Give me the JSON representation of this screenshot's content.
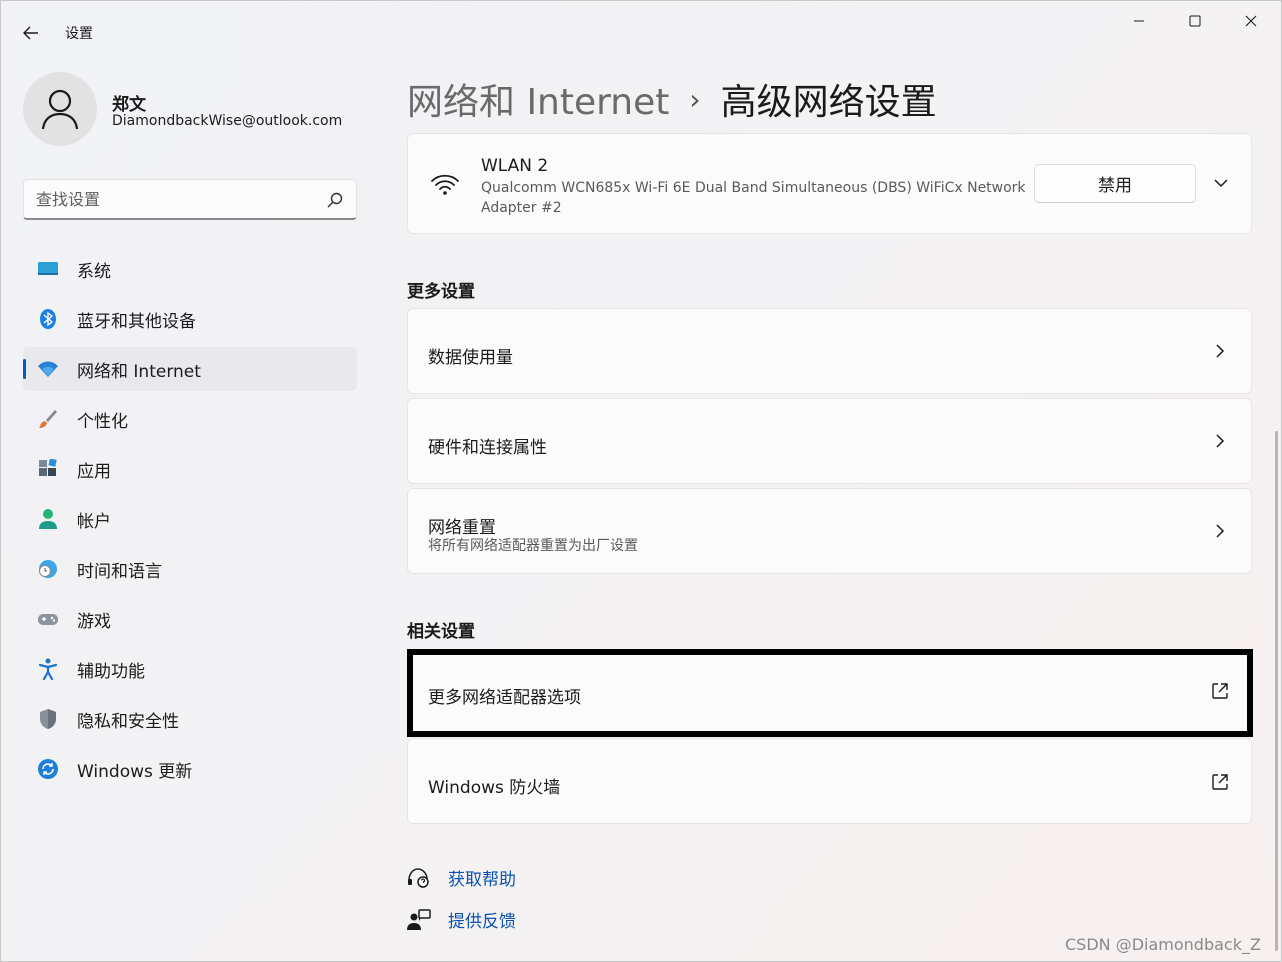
{
  "window": {
    "title": "设置",
    "controls": [
      "minimize",
      "maximize",
      "close"
    ]
  },
  "profile": {
    "name": "郑文",
    "email": "DiamondbackWise@outlook.com"
  },
  "search": {
    "placeholder": "查找设置",
    "value": ""
  },
  "sidebar": {
    "items": [
      {
        "label": "系统",
        "icon": "system-icon",
        "active": false
      },
      {
        "label": "蓝牙和其他设备",
        "icon": "bluetooth-icon",
        "active": false
      },
      {
        "label": "网络和 Internet",
        "icon": "wifi-network-icon",
        "active": true
      },
      {
        "label": "个性化",
        "icon": "brush-icon",
        "active": false
      },
      {
        "label": "应用",
        "icon": "apps-icon",
        "active": false
      },
      {
        "label": "帐户",
        "icon": "account-icon",
        "active": false
      },
      {
        "label": "时间和语言",
        "icon": "globe-clock-icon",
        "active": false
      },
      {
        "label": "游戏",
        "icon": "gamepad-icon",
        "active": false
      },
      {
        "label": "辅助功能",
        "icon": "accessibility-icon",
        "active": false
      },
      {
        "label": "隐私和安全性",
        "icon": "shield-icon",
        "active": false
      },
      {
        "label": "Windows 更新",
        "icon": "update-icon",
        "active": false
      }
    ]
  },
  "breadcrumb": {
    "parent": "网络和 Internet",
    "separator": "›",
    "current": "高级网络设置"
  },
  "adapter": {
    "name": "WLAN 2",
    "description": "Qualcomm WCN685x Wi-Fi 6E Dual Band Simultaneous (DBS) WiFiCx Network Adapter #2",
    "button": "禁用"
  },
  "more_settings": {
    "title": "更多设置",
    "items": [
      {
        "title": "数据使用量",
        "subtitle": ""
      },
      {
        "title": "硬件和连接属性",
        "subtitle": ""
      },
      {
        "title": "网络重置",
        "subtitle": "将所有网络适配器重置为出厂设置"
      }
    ]
  },
  "related_settings": {
    "title": "相关设置",
    "items": [
      {
        "title": "更多网络适配器选项",
        "highlighted": true
      },
      {
        "title": "Windows 防火墙",
        "highlighted": false
      }
    ]
  },
  "footer": {
    "help": "获取帮助",
    "feedback": "提供反馈"
  },
  "watermark": "CSDN @Diamondback_Z",
  "colors": {
    "accent": "#005fb8",
    "link": "#0a54b0",
    "highlight_border": "#000000"
  }
}
